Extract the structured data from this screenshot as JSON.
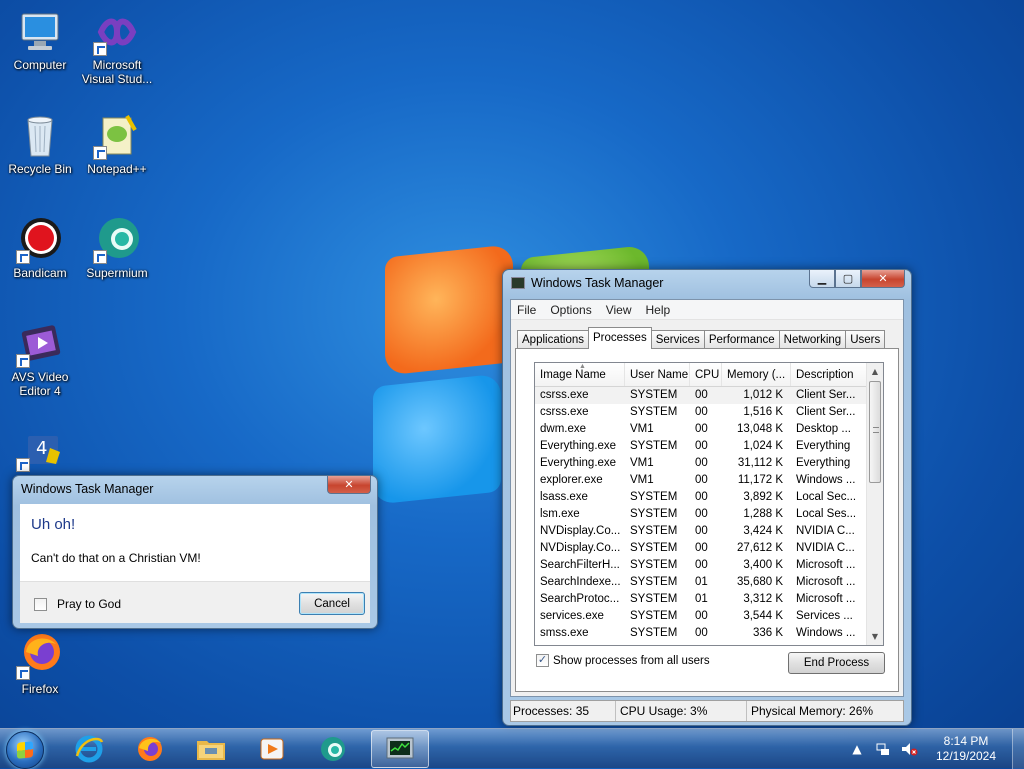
{
  "desktop": {
    "icons": [
      {
        "label": "Computer",
        "icon": "computer-icon"
      },
      {
        "label": "Microsoft Visual Stud...",
        "icon": "visual-studio-icon"
      },
      {
        "label": "Recycle Bin",
        "icon": "recycle-bin-icon"
      },
      {
        "label": "Notepad++",
        "icon": "notepad-plus-plus-icon"
      },
      {
        "label": "Bandicam",
        "icon": "bandicam-icon"
      },
      {
        "label": "Supermium",
        "icon": "supermium-icon"
      },
      {
        "label": "AVS Video Editor 4",
        "icon": "avs-video-editor-icon"
      },
      {
        "label": "",
        "icon": "vs-installer-icon"
      },
      {
        "label": "Firefox",
        "icon": "firefox-icon"
      }
    ]
  },
  "task_manager": {
    "title": "Windows Task Manager",
    "menu": [
      "File",
      "Options",
      "View",
      "Help"
    ],
    "tabs": [
      "Applications",
      "Processes",
      "Services",
      "Performance",
      "Networking",
      "Users"
    ],
    "active_tab": "Processes",
    "columns": [
      "Image Name",
      "User Name",
      "CPU",
      "Memory (...",
      "Description"
    ],
    "rows": [
      [
        "csrss.exe",
        "SYSTEM",
        "00",
        "1,012 K",
        "Client Ser..."
      ],
      [
        "csrss.exe",
        "SYSTEM",
        "00",
        "1,516 K",
        "Client Ser..."
      ],
      [
        "dwm.exe",
        "VM1",
        "00",
        "13,048 K",
        "Desktop ..."
      ],
      [
        "Everything.exe",
        "SYSTEM",
        "00",
        "1,024 K",
        "Everything"
      ],
      [
        "Everything.exe",
        "VM1",
        "00",
        "31,112 K",
        "Everything"
      ],
      [
        "explorer.exe",
        "VM1",
        "00",
        "11,172 K",
        "Windows ..."
      ],
      [
        "lsass.exe",
        "SYSTEM",
        "00",
        "3,892 K",
        "Local Sec..."
      ],
      [
        "lsm.exe",
        "SYSTEM",
        "00",
        "1,288 K",
        "Local Ses..."
      ],
      [
        "NVDisplay.Co...",
        "SYSTEM",
        "00",
        "3,424 K",
        "NVIDIA C..."
      ],
      [
        "NVDisplay.Co...",
        "SYSTEM",
        "00",
        "27,612 K",
        "NVIDIA C..."
      ],
      [
        "SearchFilterH...",
        "SYSTEM",
        "00",
        "3,400 K",
        "Microsoft ..."
      ],
      [
        "SearchIndexe...",
        "SYSTEM",
        "01",
        "35,680 K",
        "Microsoft ..."
      ],
      [
        "SearchProtoc...",
        "SYSTEM",
        "01",
        "3,312 K",
        "Microsoft ..."
      ],
      [
        "services.exe",
        "SYSTEM",
        "00",
        "3,544 K",
        "Services ..."
      ],
      [
        "smss.exe",
        "SYSTEM",
        "00",
        "336 K",
        "Windows ..."
      ]
    ],
    "show_all_label": "Show processes from all users",
    "show_all_checked": true,
    "end_process_label": "End Process",
    "status": {
      "processes": "Processes: 35",
      "cpu": "CPU Usage: 3%",
      "memory": "Physical Memory: 26%"
    }
  },
  "dialog": {
    "title": "Windows Task Manager",
    "heading": "Uh oh!",
    "message": "Can't do that on a Christian VM!",
    "checkbox_label": "Pray to God",
    "cancel_label": "Cancel"
  },
  "taskbar": {
    "apps": [
      "internet-explorer-icon",
      "firefox-icon",
      "file-explorer-icon",
      "media-player-icon",
      "supermium-icon",
      "task-manager-icon"
    ],
    "clock": {
      "time": "8:14 PM",
      "date": "12/19/2024"
    }
  },
  "colors": {
    "accent": "#1e3a8a",
    "desktop": "#1769c7",
    "close": "#c7452f"
  }
}
